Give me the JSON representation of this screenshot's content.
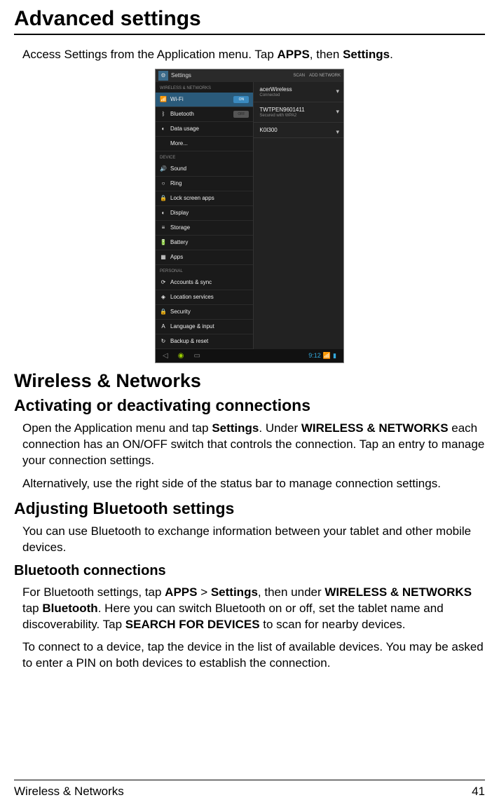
{
  "title": "Advanced settings",
  "intro": {
    "pre": "Access Settings from the Application menu. Tap ",
    "b1": "APPS",
    "mid": ", then ",
    "b2": "Settings",
    "post": "."
  },
  "screenshot": {
    "topbar": {
      "title": "Settings",
      "scan": "SCAN",
      "add": "ADD NETWORK"
    },
    "sections": {
      "wireless": "WIRELESS & NETWORKS",
      "device": "DEVICE",
      "personal": "PERSONAL"
    },
    "items": {
      "wifi": "Wi-Fi",
      "bluetooth": "Bluetooth",
      "data": "Data usage",
      "more": "More...",
      "sound": "Sound",
      "ring": "Ring",
      "lock": "Lock screen apps",
      "display": "Display",
      "storage": "Storage",
      "battery": "Battery",
      "apps": "Apps",
      "accounts": "Accounts & sync",
      "location": "Location services",
      "security": "Security",
      "language": "Language & input",
      "backup": "Backup & reset"
    },
    "toggleOn": "ON",
    "toggleOff": "OFF",
    "networks": {
      "n1": {
        "name": "acerWireless",
        "sub": "Connected"
      },
      "n2": {
        "name": "TWTPEN9601411",
        "sub": "Secured with WPA2"
      },
      "n3": {
        "name": "K0I300",
        "sub": ""
      }
    },
    "clock": "9:12"
  },
  "h2_wireless": "Wireless & Networks",
  "h3_activating": "Activating or deactivating connections",
  "p1": {
    "a": "Open the Application menu and tap ",
    "b1": "Settings",
    "b": ". Under ",
    "b2": "WIRELESS & NETWORKS",
    "c": " each connection has an ON/OFF switch that controls the connection. Tap an entry to manage your connection settings."
  },
  "p2": "Alternatively, use the right side of the status bar to manage connection settings.",
  "h3_bt": "Adjusting Bluetooth settings",
  "p3": "You can use Bluetooth to exchange information between your tablet and other mobile devices.",
  "h4_btc": "Bluetooth connections",
  "p4": {
    "a": "For Bluetooth settings, tap ",
    "b1": "APPS",
    "b": " > ",
    "b2": "Settings",
    "c": ", then under ",
    "b3": "WIRELESS & NETWORKS",
    "d": " tap ",
    "b4": "Bluetooth",
    "e": ". Here you can switch Bluetooth on or off, set the tablet name and discoverability. Tap ",
    "b5": "SEARCH FOR DEVICES",
    "f": " to scan for nearby devices."
  },
  "p5": "To connect to a device, tap the device in the list of available devices. You may be asked to enter a PIN on both devices to establish the connection.",
  "footer": {
    "left": "Wireless & Networks",
    "right": "41"
  }
}
